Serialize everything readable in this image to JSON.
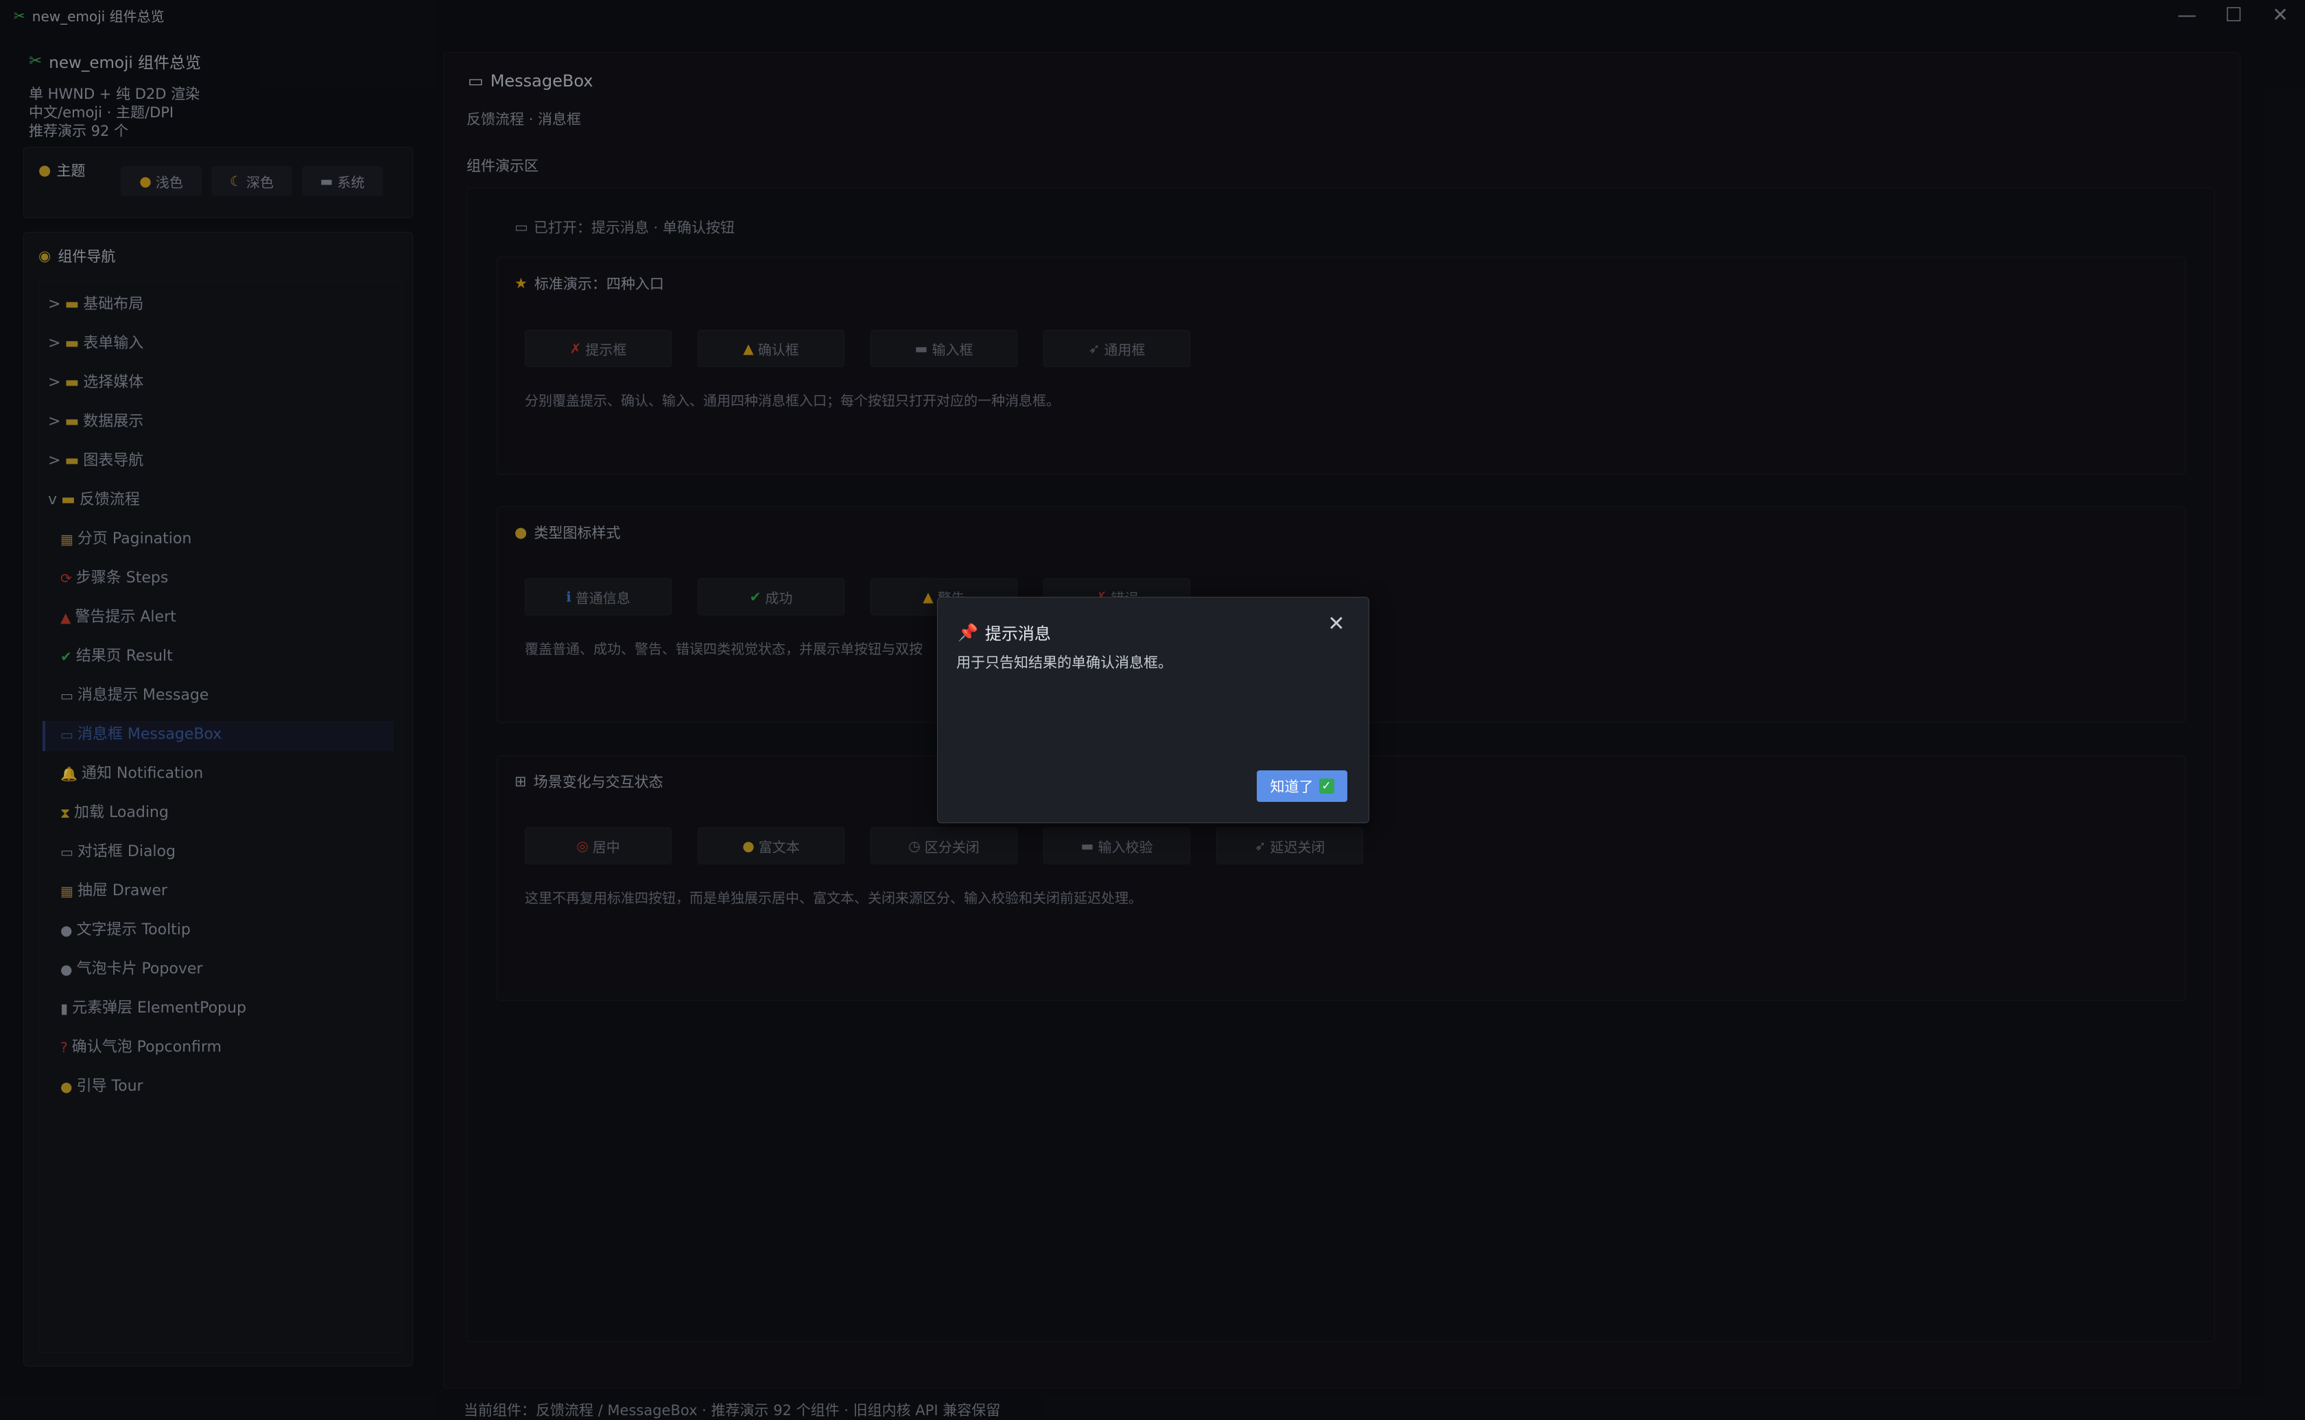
{
  "window": {
    "title": "new_emoji 组件总览",
    "minimize": "—",
    "maximize": "☐",
    "close": "✕"
  },
  "sidebar": {
    "app_title": "new_emoji 组件总览",
    "info": [
      "单 HWND + 纯 D2D 渲染",
      "中文/emoji · 主题/DPI",
      "推荐演示 92 个"
    ],
    "theme": {
      "label": "主题",
      "options": [
        "浅色",
        "深色",
        "系统"
      ]
    },
    "nav": {
      "header": "组件导航",
      "groups": [
        {
          "arrow": ">",
          "label": "基础布局"
        },
        {
          "arrow": ">",
          "label": "表单输入"
        },
        {
          "arrow": ">",
          "label": "选择媒体"
        },
        {
          "arrow": ">",
          "label": "数据展示"
        },
        {
          "arrow": ">",
          "label": "图表导航"
        },
        {
          "arrow": "v",
          "label": "反馈流程"
        }
      ],
      "children": [
        {
          "icon": "▦",
          "label": "分页 Pagination"
        },
        {
          "icon": "⟳",
          "label": "步骤条 Steps"
        },
        {
          "icon": "▲",
          "label": "警告提示 Alert"
        },
        {
          "icon": "✔",
          "label": "结果页 Result"
        },
        {
          "icon": "▭",
          "label": "消息提示 Message"
        },
        {
          "icon": "▭",
          "label": "消息框 MessageBox"
        },
        {
          "icon": "🔔",
          "label": "通知 Notification"
        },
        {
          "icon": "⧗",
          "label": "加载 Loading"
        },
        {
          "icon": "▭",
          "label": "对话框 Dialog"
        },
        {
          "icon": "▦",
          "label": "抽屉 Drawer"
        },
        {
          "icon": "●",
          "label": "文字提示 Tooltip"
        },
        {
          "icon": "●",
          "label": "气泡卡片 Popover"
        },
        {
          "icon": "▮",
          "label": "元素弹层 ElementPopup"
        },
        {
          "icon": "?",
          "label": "确认气泡 Popconfirm"
        },
        {
          "icon": "●",
          "label": "引导 Tour"
        }
      ]
    }
  },
  "main": {
    "title": "MessageBox",
    "subtitle": "反馈流程 · 消息框",
    "demo_label": "组件演示区",
    "opened": "已打开：提示消息 · 单确认按钮",
    "cards": [
      {
        "title": "标准演示：四种入口",
        "buttons": [
          "提示框",
          "确认框",
          "输入框",
          "通用框"
        ],
        "desc": "分别覆盖提示、确认、输入、通用四种消息框入口；每个按钮只打开对应的一种消息框。"
      },
      {
        "title": "类型图标样式",
        "buttons": [
          "普通信息",
          "成功",
          "警告",
          "错误"
        ],
        "desc": "覆盖普通、成功、警告、错误四类视觉状态，并展示单按钮与双按"
      },
      {
        "title": "场景变化与交互状态",
        "buttons": [
          "居中",
          "富文本",
          "区分关闭",
          "输入校验",
          "延迟关闭"
        ],
        "desc": "这里不再复用标准四按钮，而是单独展示居中、富文本、关闭来源区分、输入校验和关闭前延迟处理。"
      }
    ]
  },
  "statusbar": "当前组件：反馈流程 / MessageBox · 推荐演示 92 个组件 · 旧组内核 API 兼容保留",
  "dialog": {
    "title": "提示消息",
    "body": "用于只告知结果的单确认消息框。",
    "ok": "知道了",
    "close": "✕"
  },
  "colors": {
    "accent": "#5b8fe8",
    "success": "#2fa84f",
    "background": "#0f1015"
  }
}
